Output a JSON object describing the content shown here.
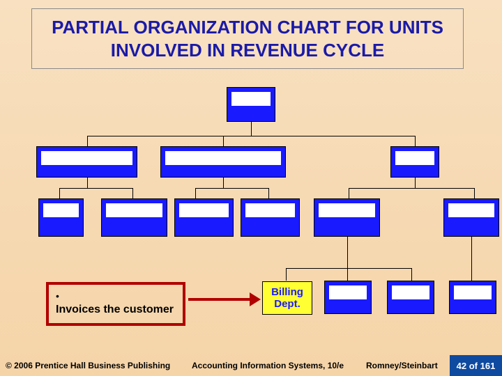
{
  "title": "PARTIAL ORGANIZATION CHART FOR UNITS INVOLVED IN REVENUE CYCLE",
  "bullet": {
    "marker": "•",
    "text": "Invoices the customer"
  },
  "highlight": {
    "line1": "Billing",
    "line2": "Dept."
  },
  "footer": {
    "copyright": "© 2006 Prentice Hall Business Publishing",
    "book": "Accounting Information Systems, 10/e",
    "authors": "Romney/Steinbart",
    "page": "42 of 161"
  },
  "chart_data": {
    "type": "org-chart",
    "description": "Hierarchical organization chart with blank labels; one leaf node highlighted as Billing Dept.",
    "levels": [
      {
        "level": 0,
        "nodes": [
          {
            "id": "root"
          }
        ]
      },
      {
        "level": 1,
        "nodes": [
          {
            "id": "a"
          },
          {
            "id": "b"
          },
          {
            "id": "c"
          }
        ]
      },
      {
        "level": 2,
        "nodes": [
          {
            "id": "a1",
            "parent": "a"
          },
          {
            "id": "a2",
            "parent": "a"
          },
          {
            "id": "b1",
            "parent": "b"
          },
          {
            "id": "b2",
            "parent": "b"
          },
          {
            "id": "c1",
            "parent": "c"
          },
          {
            "id": "c2",
            "parent": "c"
          }
        ]
      },
      {
        "level": 3,
        "nodes": [
          {
            "id": "c1a",
            "parent": "c1",
            "label": "Billing Dept.",
            "highlighted": true
          },
          {
            "id": "c1b",
            "parent": "c1"
          },
          {
            "id": "c1c",
            "parent": "c1"
          },
          {
            "id": "c2a",
            "parent": "c2"
          }
        ]
      }
    ]
  }
}
